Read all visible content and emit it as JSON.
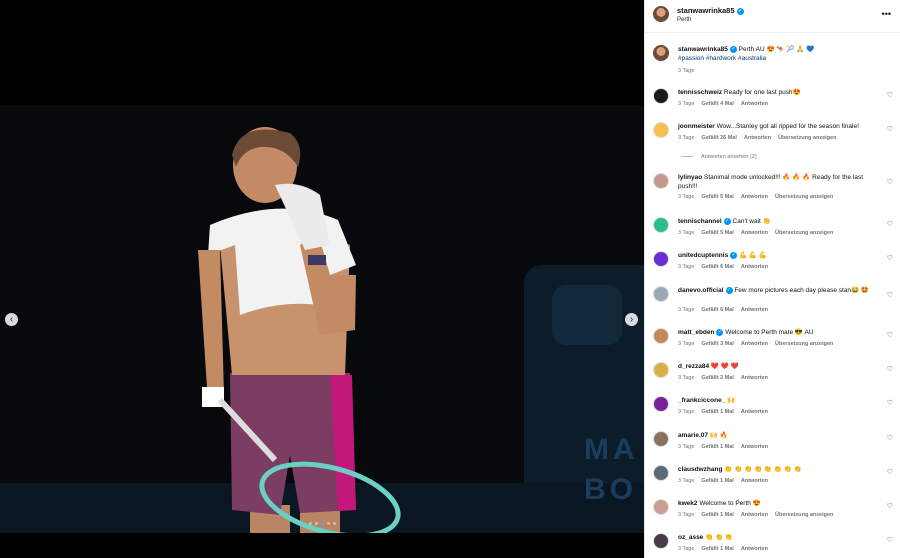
{
  "media": {
    "prev_icon": "‹",
    "next_icon": "›",
    "brand_text": "MA\nBO",
    "slides": 5,
    "active_slide": 3
  },
  "post": {
    "username": "stanwawrinka85",
    "location": "Perth",
    "more_icon": "•••",
    "caption": "Perth AU 😍 🦘 🎾 🙏 💙",
    "hashtags": "#passion #hardwork #australia",
    "age": "3 Tage"
  },
  "comments": [
    {
      "user": "tennisschweiz",
      "verified": false,
      "text": "Ready for one last push😍",
      "age": "3 Tage",
      "likes": "Gefällt 4 Mal",
      "reply": "Antworten",
      "translate": ""
    },
    {
      "user": "joonmeister",
      "verified": false,
      "text": "Wow...Stanley got all ripped for the season finale!",
      "age": "3 Tage",
      "likes": "Gefällt 26 Mal",
      "reply": "Antworten",
      "translate": "Übersetzung anzeigen"
    },
    {
      "user": "lylinyao",
      "verified": false,
      "text": "Stanimal mode unlocked!!! 🔥 🔥 🔥 Ready for the last push!!!",
      "age": "3 Tage",
      "likes": "Gefällt 5 Mal",
      "reply": "Antworten",
      "translate": "Übersetzung anzeigen"
    },
    {
      "user": "tennischannel",
      "verified": true,
      "text": "Can't wait 👏",
      "age": "3 Tage",
      "likes": "Gefällt 5 Mal",
      "reply": "Antworten",
      "translate": "Übersetzung anzeigen"
    },
    {
      "user": "unitedcuptennis",
      "verified": true,
      "text": "💪 💪 💪",
      "age": "3 Tage",
      "likes": "Gefällt 6 Mal",
      "reply": "Antworten",
      "translate": ""
    },
    {
      "user": "danevo.official",
      "verified": true,
      "text": "Few more pictures each day please stan😂 🤩",
      "age": "3 Tage",
      "likes": "Gefällt 6 Mal",
      "reply": "Antworten",
      "translate": ""
    },
    {
      "user": "matt_ebden",
      "verified": true,
      "text": "Welcome to Perth mate 😎 AU",
      "age": "3 Tage",
      "likes": "Gefällt 3 Mal",
      "reply": "Antworten",
      "translate": "Übersetzung anzeigen"
    },
    {
      "user": "d_rezza84",
      "verified": false,
      "text": "❤️ ❤️ ❤️",
      "age": "3 Tage",
      "likes": "Gefällt 2 Mal",
      "reply": "Antworten",
      "translate": ""
    },
    {
      "user": "_frankciccone_",
      "verified": false,
      "text": "🙌",
      "age": "3 Tage",
      "likes": "Gefällt 1 Mal",
      "reply": "Antworten",
      "translate": ""
    },
    {
      "user": "amarie.07",
      "verified": false,
      "text": "🙌 🔥",
      "age": "3 Tage",
      "likes": "Gefällt 1 Mal",
      "reply": "Antworten",
      "translate": ""
    },
    {
      "user": "clausdwzhang",
      "verified": false,
      "text": "👏 👏 👏 👏 👏 👏 👏 👏",
      "age": "3 Tage",
      "likes": "Gefällt 1 Mal",
      "reply": "Antworten",
      "translate": ""
    },
    {
      "user": "kwek2",
      "verified": false,
      "text": "Welcome to Perth 😍",
      "age": "3 Tage",
      "likes": "Gefällt 1 Mal",
      "reply": "Antworten",
      "translate": "Übersetzung anzeigen"
    },
    {
      "user": "oz_asse",
      "verified": false,
      "text": "👏 👏 👏",
      "age": "3 Tage",
      "likes": "Gefällt 1 Mal",
      "reply": "Antworten",
      "translate": ""
    }
  ],
  "view_replies": "Antworten ansehen (2)",
  "heart_icon": "♡",
  "colors": {
    "link": "#00376b",
    "verified": "#0095f6",
    "meta": "#737373"
  }
}
